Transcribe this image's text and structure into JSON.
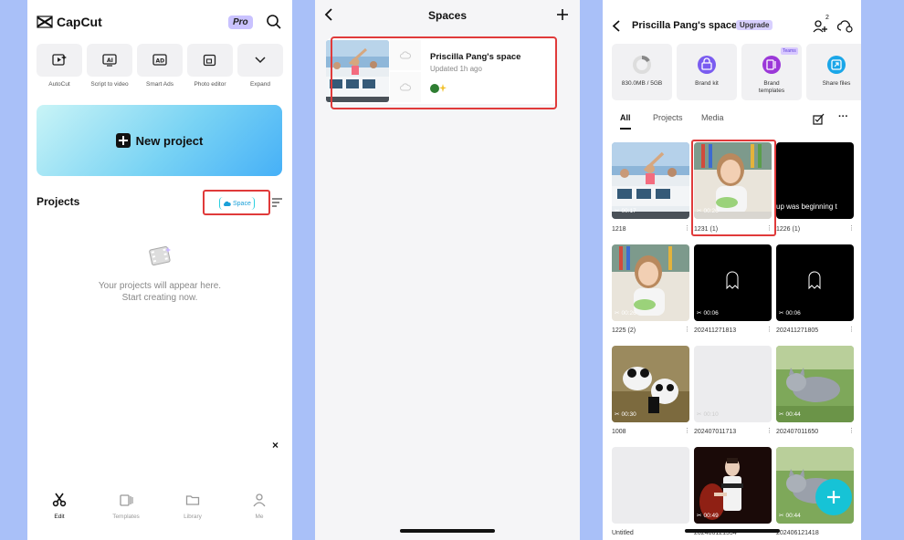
{
  "colors": {
    "accent_red": "#e03a3a",
    "fab": "#16c3d6",
    "new_project_gradient": [
      "#c9f4f6",
      "#46b0f7"
    ]
  },
  "panel1": {
    "brand": "CapCut",
    "pro_label": "Pro",
    "tools": [
      {
        "label": "AutoCut",
        "icon": "autocut-icon"
      },
      {
        "label": "Script to video",
        "icon": "script-ai-icon"
      },
      {
        "label": "Smart Ads",
        "icon": "smart-ads-icon"
      },
      {
        "label": "Photo editor",
        "icon": "photo-editor-icon"
      },
      {
        "label": "Expand",
        "icon": "chevron-down-icon"
      }
    ],
    "new_project_label": "New project",
    "projects_title": "Projects",
    "space_label": "Space",
    "empty_line1": "Your projects will appear here.",
    "empty_line2": "Start creating now.",
    "close_glyph": "×",
    "nav": [
      {
        "label": "Edit",
        "icon": "scissors-icon",
        "active": true
      },
      {
        "label": "Templates",
        "icon": "templates-icon",
        "active": false
      },
      {
        "label": "Library",
        "icon": "folder-icon",
        "active": false
      },
      {
        "label": "Me",
        "icon": "person-icon",
        "active": false
      }
    ]
  },
  "panel2": {
    "title": "Spaces",
    "space_name": "Priscilla Pang's space",
    "space_updated": "Updated 1h ago"
  },
  "panel3": {
    "title": "Priscilla Pang's space",
    "upgrade_label": "Upgrade",
    "add_member_count": "2",
    "quick": [
      {
        "label": "830.0MB / 5GB",
        "icon": "storage-ring-icon"
      },
      {
        "label": "Brand kit",
        "icon": "brand-kit-icon"
      },
      {
        "label": "Brand templates",
        "icon": "brand-templates-icon",
        "badge": "Teams"
      },
      {
        "label": "Share files",
        "icon": "share-files-icon"
      }
    ],
    "tabs": [
      {
        "label": "All",
        "active": true
      },
      {
        "label": "Projects",
        "active": false
      },
      {
        "label": "Media",
        "active": false
      }
    ],
    "items": [
      {
        "name": "1218",
        "duration": "00:17",
        "thumb": "bus"
      },
      {
        "name": "1231 (1)",
        "duration": "00:26",
        "thumb": "girl"
      },
      {
        "name": "1226 (1)",
        "duration": "",
        "thumb": "black-text",
        "overlay": "up was beginning t"
      },
      {
        "name": "1225 (2)",
        "duration": "00:26",
        "thumb": "girl"
      },
      {
        "name": "202411271813",
        "duration": "00:06",
        "thumb": "black-ghost"
      },
      {
        "name": "202411271805",
        "duration": "00:06",
        "thumb": "black-ghost"
      },
      {
        "name": "1008",
        "duration": "00:30",
        "thumb": "panda"
      },
      {
        "name": "202407011713",
        "duration": "00:10",
        "thumb": "blank"
      },
      {
        "name": "202407011650",
        "duration": "00:44",
        "thumb": "cat"
      },
      {
        "name": "Untitled",
        "duration": "",
        "thumb": "blank"
      },
      {
        "name": "202406121554",
        "duration": "00:49",
        "thumb": "stage"
      },
      {
        "name": "202406121418",
        "duration": "00:44",
        "thumb": "cat"
      }
    ]
  }
}
